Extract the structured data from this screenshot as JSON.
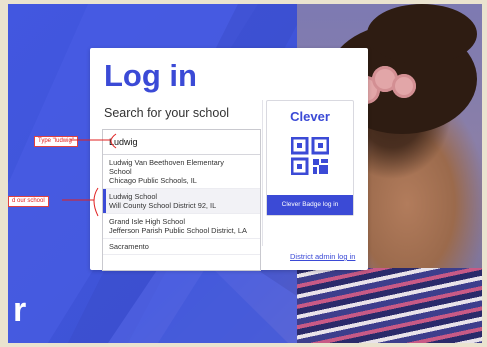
{
  "login": {
    "title": "Log in",
    "search_label": "Search for your school",
    "search_value": "Ludwig",
    "results": [
      {
        "lines": [
          "Ludwig Van Beethoven Elementary",
          "School",
          "Chicago Public Schools, IL"
        ]
      },
      {
        "lines": [
          "Ludwig School",
          "Will County School District 92, IL"
        ],
        "highlighted": true
      },
      {
        "lines": [
          "Grand Isle High School",
          "Jefferson Parish Public School District, LA"
        ]
      },
      {
        "lines": [
          "Sacramento"
        ]
      }
    ],
    "badge_title": "Clever",
    "badge_button": "Clever Badge log in",
    "district_link": "District admin log in"
  },
  "annotations": {
    "type_hint": "Type \"ludwig\"",
    "find_hint": "d our school"
  },
  "background": {
    "letter": "r"
  },
  "colors": {
    "brand": "#3b4ad6",
    "annotation": "#e02020",
    "background": "#4257e0"
  },
  "icons": {
    "badge": "qr-code-icon"
  }
}
